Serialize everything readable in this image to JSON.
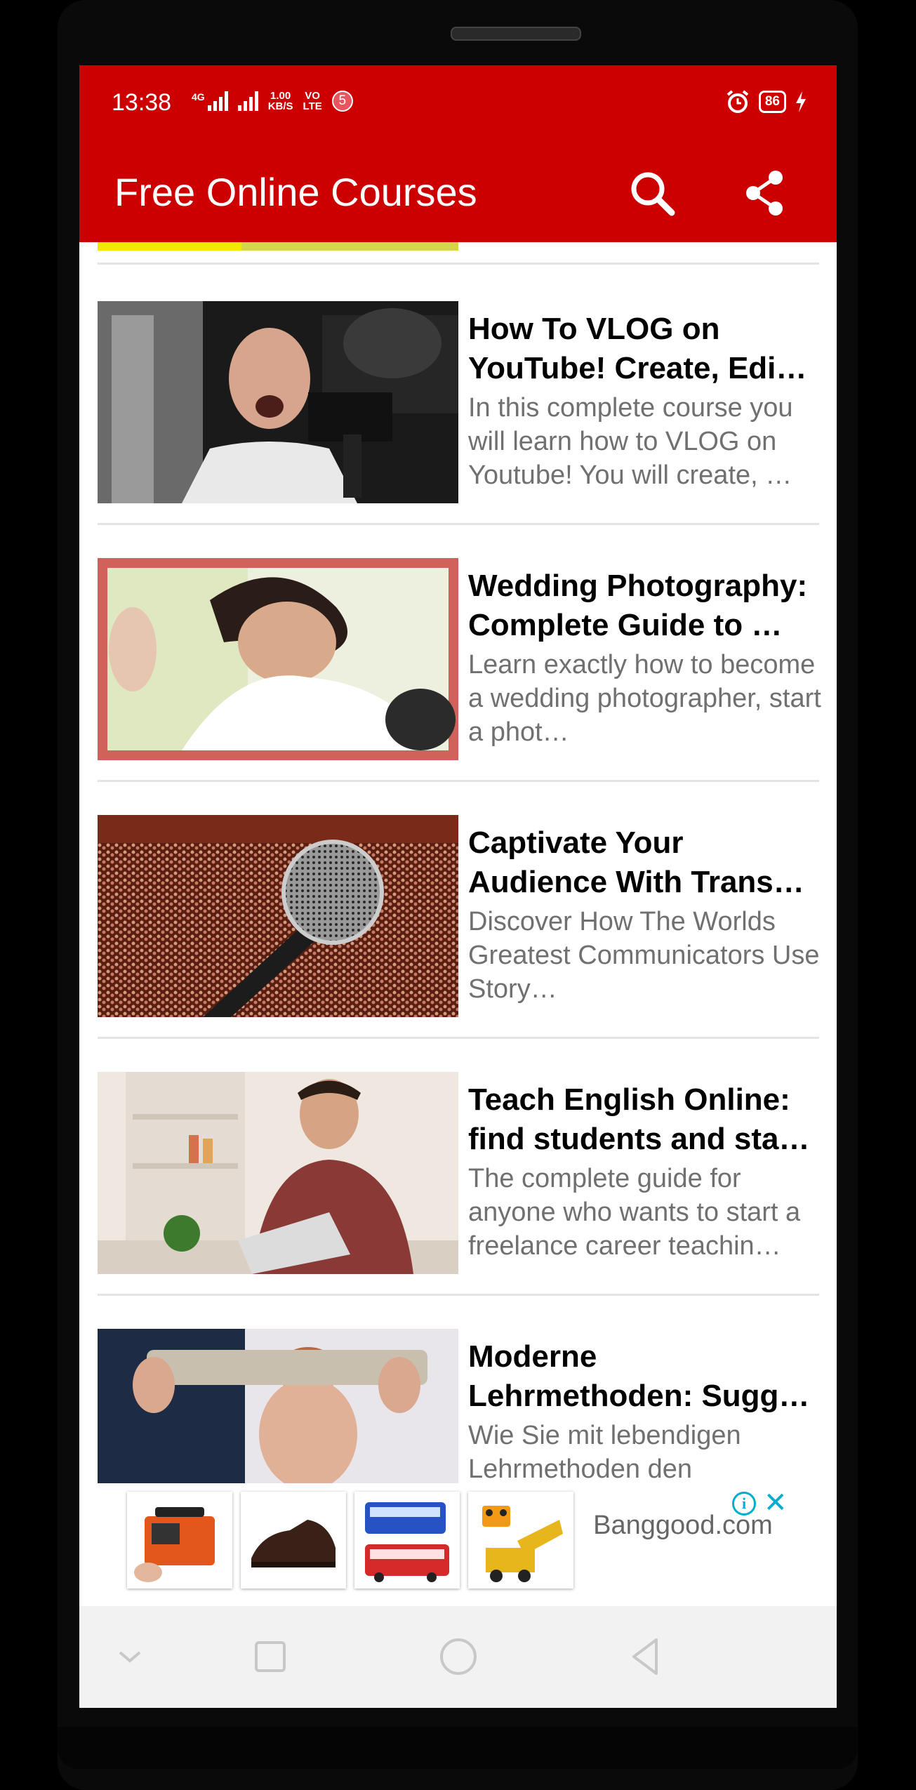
{
  "status_bar": {
    "time": "13:38",
    "network_type": "4G",
    "net_speed_value": "1.00",
    "net_speed_unit": "KB/S",
    "volte_top": "VO",
    "volte_bottom": "LTE",
    "notification_count": "5",
    "battery": "86"
  },
  "app_bar": {
    "title": "Free Online Courses",
    "search_icon": "search-icon",
    "share_icon": "share-icon"
  },
  "courses": [
    {
      "title": "How To VLOG on YouTube! Create, Edi…",
      "description": "In this complete course you will learn how to VLOG on Youtube! You will create, …"
    },
    {
      "title": "Wedding Photography: Complete Guide to …",
      "description": "Learn exactly how to become a wedding photographer, start a phot…"
    },
    {
      "title": "Captivate Your Audience With Trans…",
      "description": "Discover How The Worlds Greatest Communicators Use Story…"
    },
    {
      "title": "Teach English Online: find students and sta…",
      "description": "The complete guide for anyone who wants to start a freelance career teachin…"
    },
    {
      "title": "Moderne Lehrmethoden: Sugg…",
      "description": "Wie Sie mit lebendigen Lehrmethoden den"
    }
  ],
  "ad": {
    "brand": "Banggood.com",
    "info_icon": "info-icon",
    "close_icon": "close-icon",
    "info_glyph": "i",
    "close_glyph": "✕"
  },
  "colors": {
    "app_bar": "#cc0000",
    "accent_ad": "#00aecd",
    "title_text": "#000000",
    "description_text": "#707070"
  }
}
